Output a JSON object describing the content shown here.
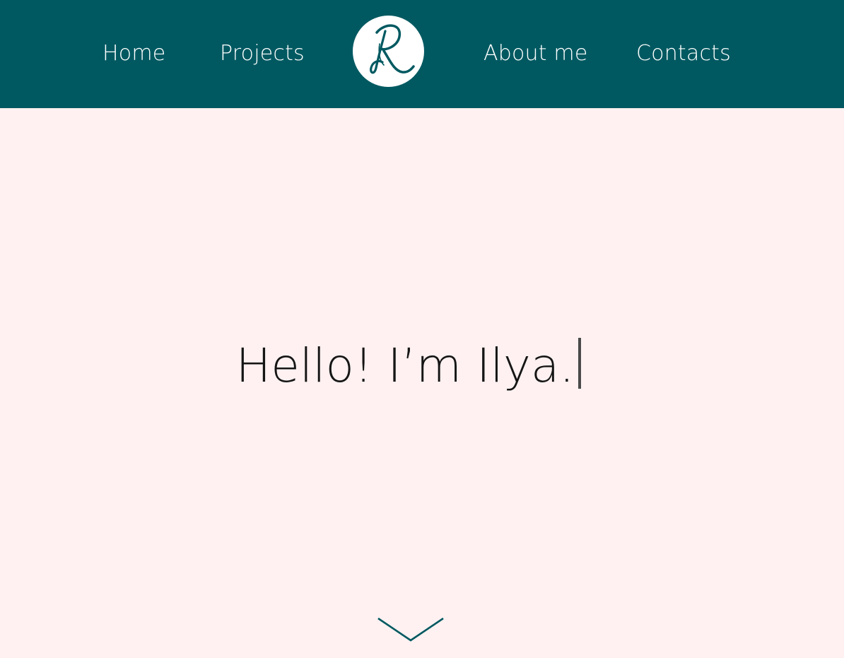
{
  "nav": {
    "home": "Home",
    "projects": "Projects",
    "about": "About me",
    "contacts": "Contacts"
  },
  "logo": {
    "icon": "script-r-monogram-icon"
  },
  "hero": {
    "greeting": "Hello! I’m Ilya."
  },
  "scroll": {
    "icon": "chevron-down-icon"
  },
  "colors": {
    "header_bg": "#005961",
    "page_bg": "#fff1f1",
    "text": "#151515",
    "accent": "#005961"
  }
}
